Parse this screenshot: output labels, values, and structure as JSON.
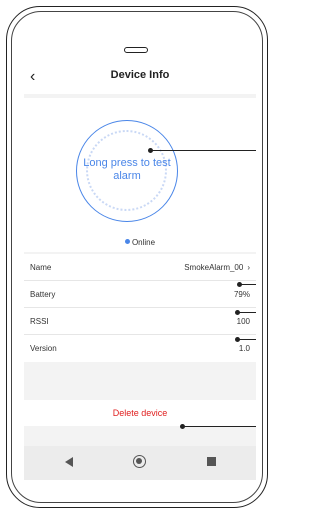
{
  "header": {
    "back_icon": "‹",
    "title": "Device Info"
  },
  "alarm": {
    "label": "Long press to test alarm",
    "accent": "#4a86e8"
  },
  "status": {
    "text": "Online"
  },
  "rows": [
    {
      "label": "Name",
      "value": "SmokeAlarm_00",
      "chevron": "›"
    },
    {
      "label": "Battery",
      "value": "79%"
    },
    {
      "label": "RSSI",
      "value": "100"
    },
    {
      "label": "Version",
      "value": "1.0"
    }
  ],
  "delete": {
    "label": "Delete device",
    "color": "#e02020"
  },
  "navbar": {
    "back": "back-triangle-icon",
    "home": "home-circle-icon",
    "recent": "recent-square-icon"
  }
}
